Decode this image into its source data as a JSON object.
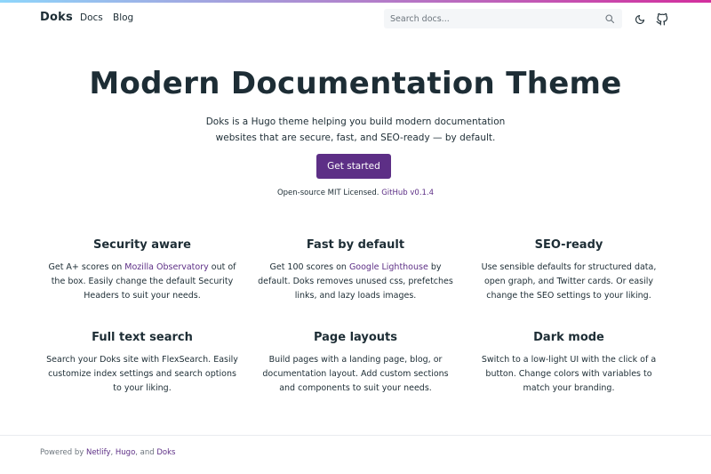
{
  "navbar": {
    "brand": "Doks",
    "links": [
      "Docs",
      "Blog"
    ],
    "search_placeholder": "Search docs...",
    "accent_gradient": [
      "#8ed6fb",
      "#d32e9d"
    ]
  },
  "hero": {
    "title": "Modern Documentation Theme",
    "lead_line1": "Doks is a Hugo theme helping you build modern documentation",
    "lead_line2": "websites that are secure, fast, and SEO-ready — by default.",
    "cta_label": "Get started",
    "meta_prefix": "Open-source MIT Licensed.",
    "meta_link": "GitHub v0.1.4"
  },
  "features": [
    {
      "title": "Security aware",
      "pre": "Get A+ scores on ",
      "link": "Mozilla Observatory",
      "post": " out of the box. Easily change the default Security Headers to suit your needs."
    },
    {
      "title": "Fast by default",
      "pre": "Get 100 scores on ",
      "link": "Google Lighthouse",
      "post": " by default. Doks removes unused css, prefetches links, and lazy loads images."
    },
    {
      "title": "SEO-ready",
      "pre": "Use sensible defaults for structured data, open graph, and Twitter cards. Or easily change the SEO settings to your liking.",
      "link": "",
      "post": ""
    },
    {
      "title": "Full text search",
      "pre": "Search your Doks site with FlexSearch. Easily customize index settings and search options to your liking.",
      "link": "",
      "post": ""
    },
    {
      "title": "Page layouts",
      "pre": "Build pages with a landing page, blog, or documentation layout. Add custom sections and components to suit your needs.",
      "link": "",
      "post": ""
    },
    {
      "title": "Dark mode",
      "pre": "Switch to a low-light UI with the click of a button. Change colors with variables to match your branding.",
      "link": "",
      "post": ""
    }
  ],
  "footer": {
    "prefix": "Powered by ",
    "link1": "Netlify",
    "sep1": ", ",
    "link2": "Hugo",
    "sep2": ", and ",
    "link3": "Doks"
  },
  "colors": {
    "brand_purple": "#5d2f86",
    "text": "#1d2d35"
  },
  "icons": [
    "search-icon",
    "moon-icon",
    "github-icon"
  ]
}
